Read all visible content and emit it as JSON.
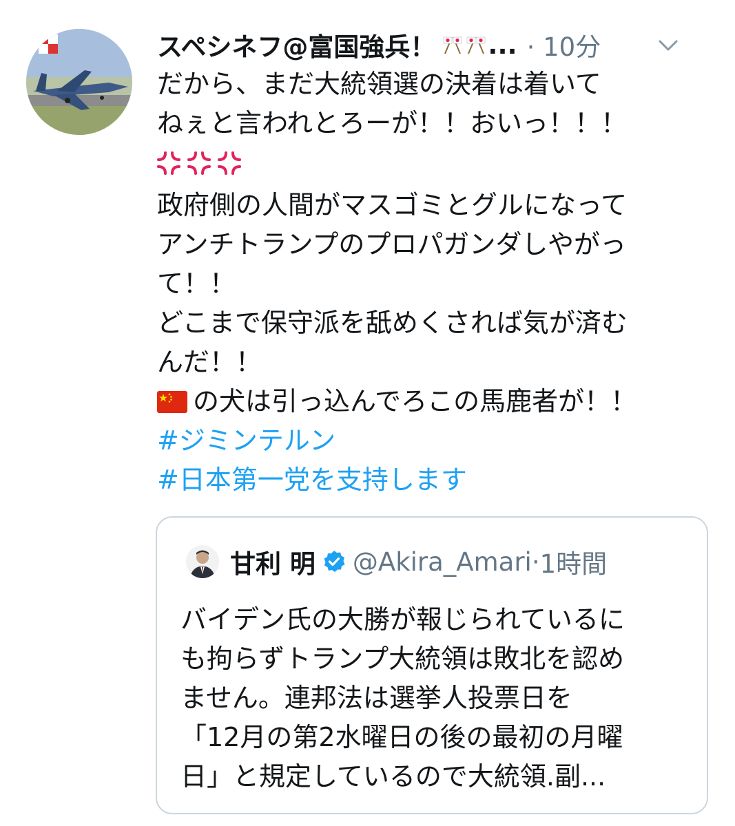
{
  "tweet": {
    "display_name": "スペシネフ@富国強兵！",
    "name_ellipsis": "...",
    "separator": " · ",
    "time": "10分",
    "icons": {
      "avatar": "fighter-jet-avatar",
      "name_emoji": "crossed-flags-icon",
      "caret": "chevron-down-icon",
      "anger": "anger-symbol-icon",
      "china_flag": "china-flag-icon"
    },
    "lines": [
      "だから、まだ大統領選の決着は着いて",
      "ねぇと言われとろーが！！おいっ！！！",
      "政府側の人間がマスゴミとグルになって",
      "アンチトランプのプロパガンダしやがっ",
      "て！！",
      "どこまで保守派を舐めくされば気が済む",
      "んだ！！",
      "の犬は引っ込んでろこの馬鹿者が！！"
    ],
    "hashtags": [
      "#ジミンテルン",
      "#日本第一党を支持します"
    ]
  },
  "quote": {
    "name": "甘利 明",
    "handle": "@Akira_Amari",
    "separator": " · ",
    "time": "1時間",
    "verified_icon": "verified-badge-icon",
    "lines": [
      "バイデン氏の大勝が報じられているに",
      "も拘らずトランプ大統領は敗北を認め",
      "ません。連邦法は選挙人投票日を",
      "「12月の第2水曜日の後の最初の月曜",
      "日」と規定しているので大統領.副..."
    ]
  },
  "colors": {
    "text": "#14171a",
    "secondary": "#657786",
    "link": "#1da1f2",
    "border": "#ccd6dd",
    "verified": "#1da1f2",
    "anger": "#e0245e",
    "china_red": "#de2910"
  }
}
